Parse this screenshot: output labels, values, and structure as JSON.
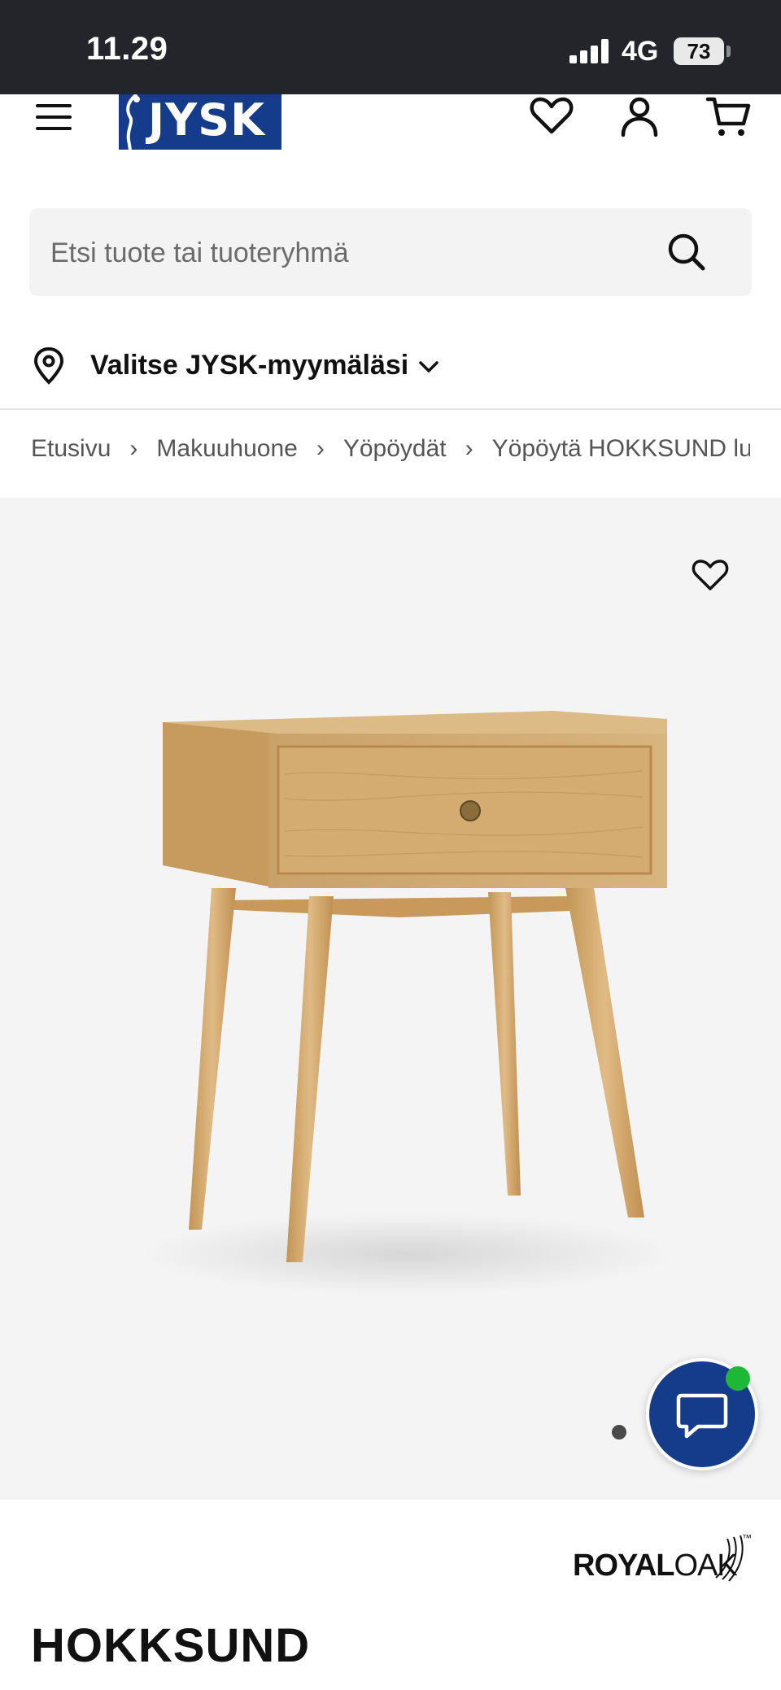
{
  "status_bar": {
    "time": "11.29",
    "network": "4G",
    "battery": "73"
  },
  "header": {
    "logo_text": "JYSK",
    "icons": [
      "menu-icon",
      "heart-icon",
      "user-icon",
      "cart-icon"
    ]
  },
  "search": {
    "placeholder": "Etsi tuote tai tuoteryhmä"
  },
  "store_selector": {
    "label": "Valitse JYSK-myymäläsi"
  },
  "breadcrumb": [
    "Etusivu",
    "Makuuhuone",
    "Yöpöydät",
    "Yöpöytä HOKKSUND lu"
  ],
  "product": {
    "brand_part1": "ROYAL",
    "brand_part2": "OAK",
    "brand_tm": "™",
    "title": "HOKKSUND"
  },
  "colors": {
    "brand_blue": "#143c8a",
    "status_bar": "#24252a",
    "gallery_bg": "#f4f4f4",
    "online_green": "#1db835"
  }
}
